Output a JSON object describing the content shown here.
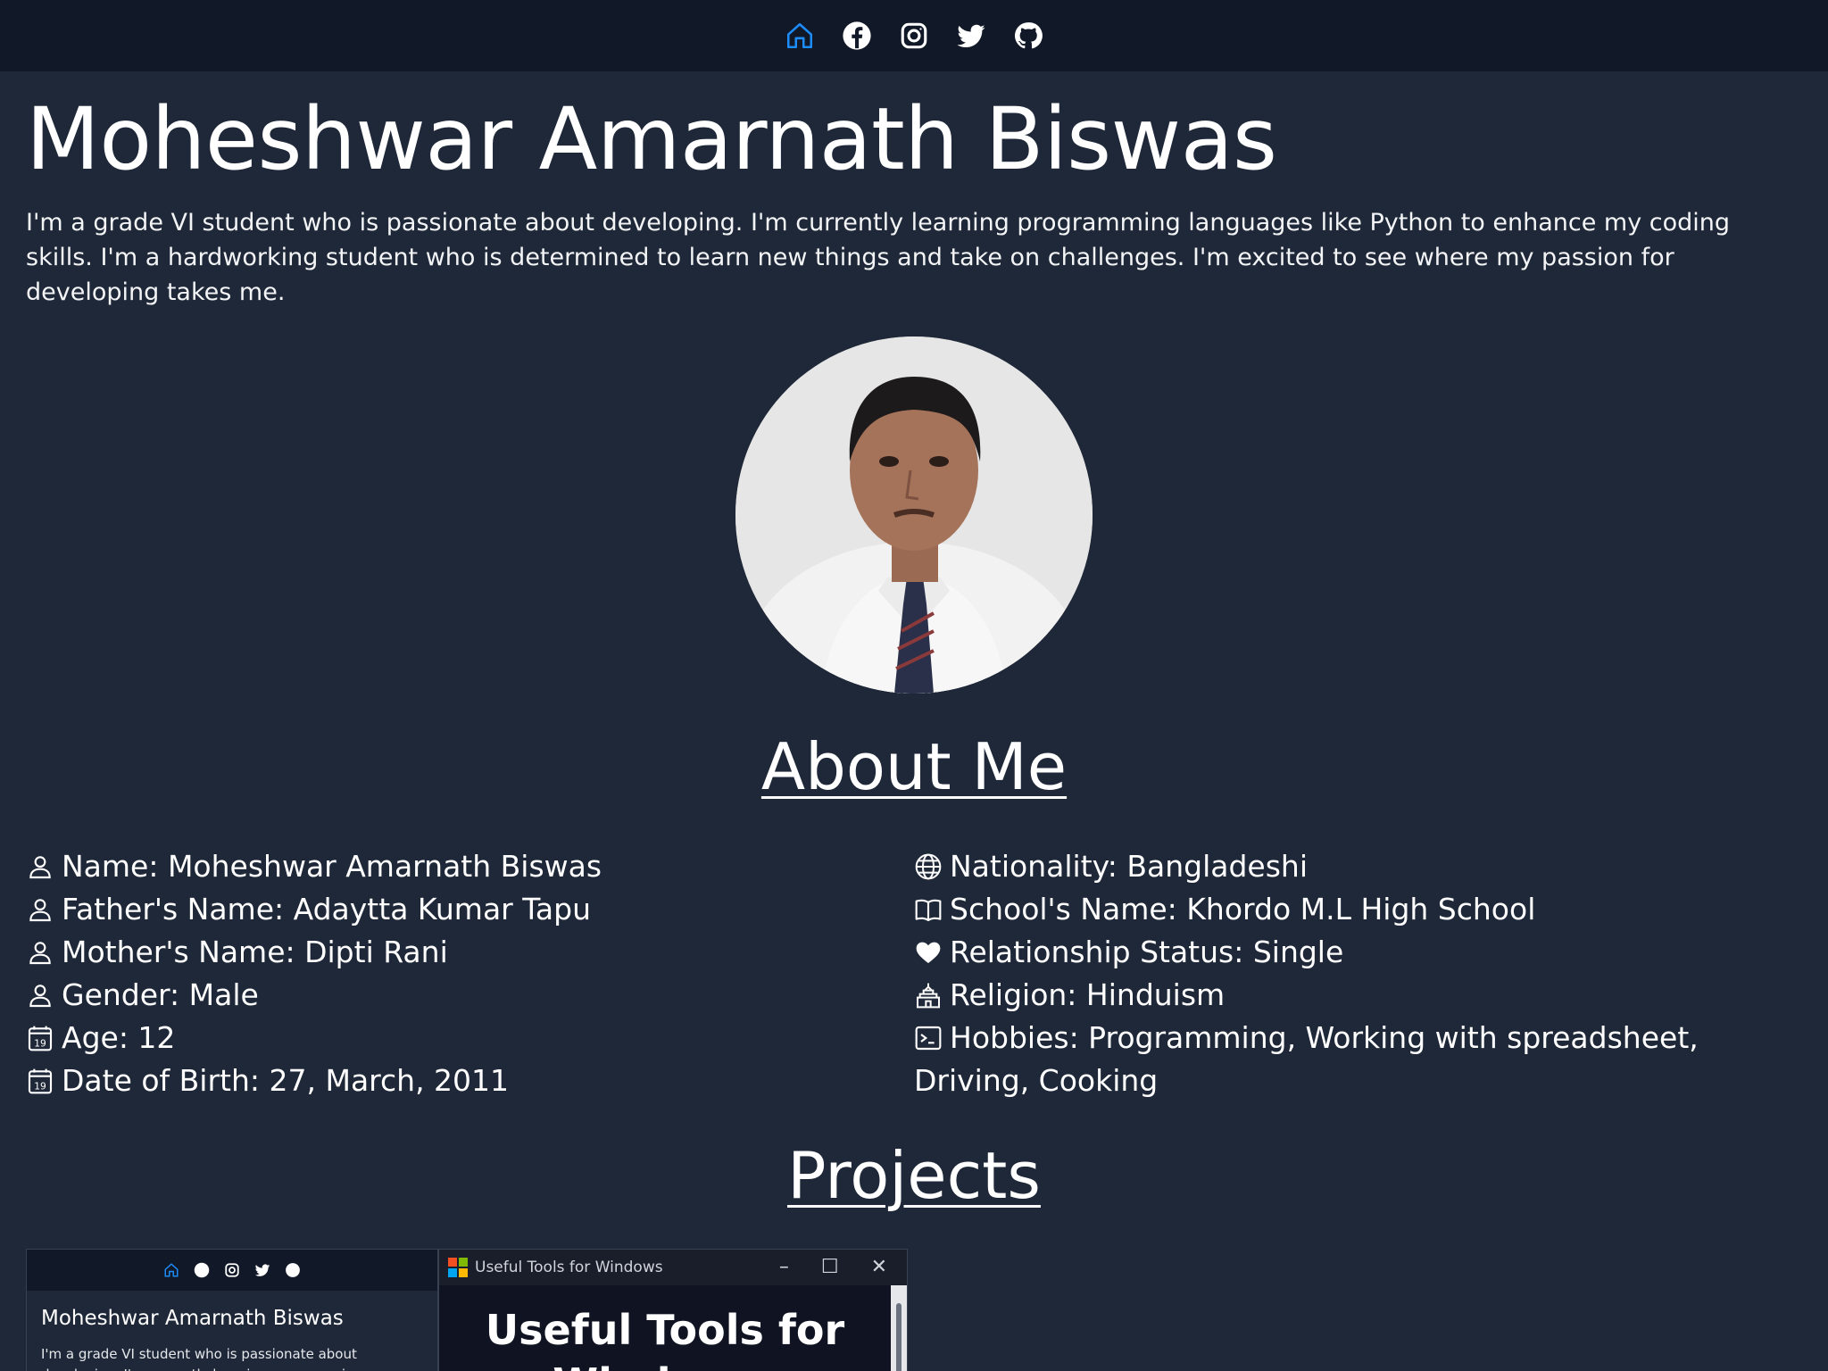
{
  "nav": {
    "icons": [
      "home-icon",
      "facebook-icon",
      "instagram-icon",
      "twitter-icon",
      "github-icon"
    ],
    "active_color": "#1d8cf8"
  },
  "header": {
    "name": "Moheshwar Amarnath Biswas",
    "bio": "I'm a grade VI student who is passionate about developing. I'm currently learning programming languages like Python to enhance my coding skills. I'm a hardworking student who is determined to learn new things and take on challenges. I'm excited to see where my passion for developing takes me."
  },
  "about": {
    "title": "About Me",
    "left": [
      {
        "icon": "person-icon",
        "text": "Name: Moheshwar Amarnath Biswas"
      },
      {
        "icon": "person-icon",
        "text": "Father's Name: Adaytta Kumar Tapu"
      },
      {
        "icon": "person-icon",
        "text": "Mother's Name: Dipti Rani"
      },
      {
        "icon": "person-icon",
        "text": "Gender: Male"
      },
      {
        "icon": "calendar-icon",
        "text": "Age: 12"
      },
      {
        "icon": "calendar-icon",
        "text": "Date of Birth: 27, March, 2011"
      }
    ],
    "right": [
      {
        "icon": "globe-icon",
        "text": "Nationality: Bangladeshi"
      },
      {
        "icon": "book-icon",
        "text": "School's Name: Khordo M.L High School"
      },
      {
        "icon": "heart-icon",
        "text": "Relationship Status: Single"
      },
      {
        "icon": "temple-icon",
        "text": "Religion: Hinduism"
      },
      {
        "icon": "terminal-icon",
        "text": "Hobbies: Programming, Working with spreadsheet, Driving, Cooking"
      }
    ]
  },
  "projects": {
    "title": "Projects",
    "items": [
      {
        "mini_title": "Moheshwar Amarnath Biswas",
        "mini_bio": "I'm a grade VI student who is passionate about developing. I'm currently learning programming languages like Python to enhance my coding skills. I'm a"
      },
      {
        "window_title": "Useful Tools for Windows",
        "heading": "Useful Tools for Windows."
      }
    ]
  }
}
